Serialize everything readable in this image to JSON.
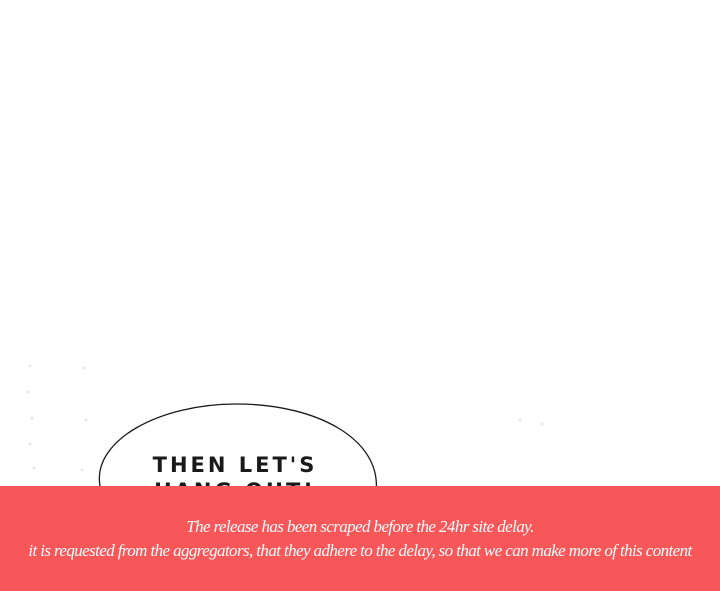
{
  "comic_panel": {
    "speech_bubble_text": "THEN LET'S\nHANG OUT!"
  },
  "notice_banner": {
    "line1": "The release has been scraped before the 24hr site delay.",
    "line2": "it is requested from the aggregators, that they adhere to the delay, so that we can make more of this content",
    "background_color": "#f8575a",
    "text_color": "#ffffff"
  }
}
